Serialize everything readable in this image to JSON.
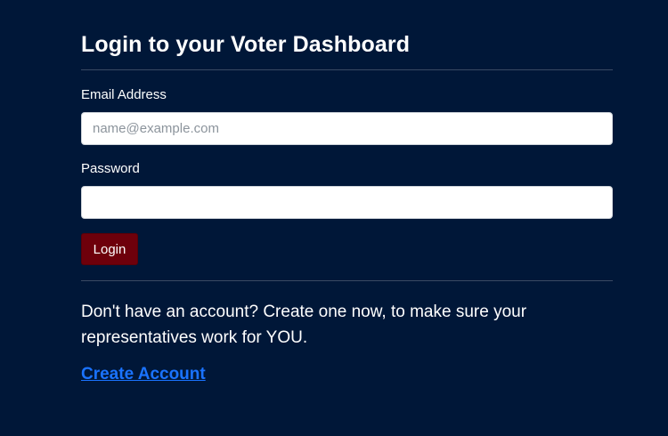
{
  "heading": "Login to your Voter Dashboard",
  "form": {
    "email_label": "Email Address",
    "email_placeholder": "name@example.com",
    "email_value": "",
    "password_label": "Password",
    "password_value": "",
    "login_label": "Login"
  },
  "signup": {
    "text": "Don't have an account? Create one now, to make sure your representatives work for YOU.",
    "link_label": "Create Account"
  },
  "colors": {
    "background": "#001738",
    "button": "#6e000b",
    "link": "#1a73ff"
  }
}
